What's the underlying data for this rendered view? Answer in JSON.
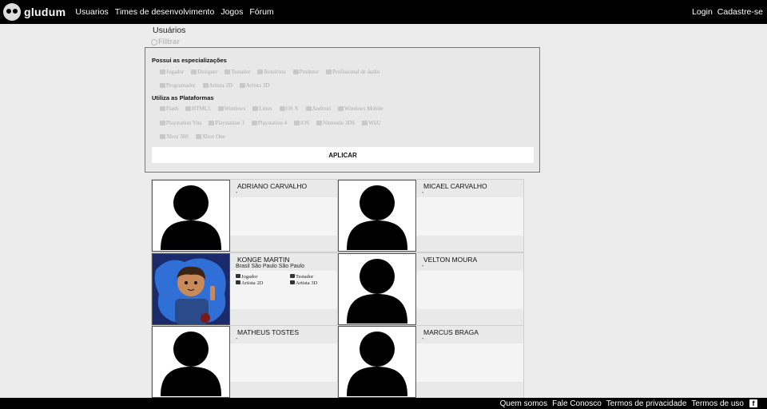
{
  "header": {
    "logo_text": "gludum",
    "nav": [
      "Usuarios",
      "Times de desenvolvimento",
      "Jogos",
      "Fórum"
    ],
    "login": "Login",
    "signup": "Cadastre-se"
  },
  "page_title": "Usuários",
  "filter_toggle": "Filtrar",
  "filters": {
    "specializations_title": "Possui as especializações",
    "specializations_row1": [
      "Jogador",
      "Designer",
      "Testador",
      "Roteirista",
      "Produtor",
      "Profissional de áudio"
    ],
    "specializations_row2": [
      "Programador",
      "Artista 2D",
      "Artista 3D"
    ],
    "platforms_title": "Utiliza as Plataformas",
    "platforms_row1": [
      "Flash",
      "HTML5",
      "Windows",
      "Linux",
      "OS X",
      "Android",
      "Windows Mobile"
    ],
    "platforms_row2": [
      "Playstation Vita",
      "Playstation 3",
      "Playstation 4",
      "iOS",
      "Nintendo 3DS",
      "WiiU"
    ],
    "platforms_row3": [
      "Xbox 360",
      "Xbox One"
    ],
    "apply_label": "APLICAR"
  },
  "users": [
    {
      "name": "ADRIANO CARVALHO",
      "location": "-",
      "tags": []
    },
    {
      "name": "MICAEL CARVALHO",
      "location": "-",
      "tags": []
    },
    {
      "name": "KONGE MARTIN",
      "location": "Brasil São Paulo São Paulo",
      "tags": [
        "Jogador",
        "Testador",
        "Artista 2D",
        "Artista 3D"
      ]
    },
    {
      "name": "VELTON MOURA",
      "location": "-",
      "tags": []
    },
    {
      "name": "MATHEUS TOSTES",
      "location": "-",
      "tags": []
    },
    {
      "name": "MARCUS BRAGA",
      "location": "-",
      "tags": []
    }
  ],
  "footer": {
    "links": [
      "Quem somos",
      "Fale Conosco",
      "Termos de privacidade",
      "Termos de uso"
    ],
    "facebook_icon": "facebook-icon"
  }
}
